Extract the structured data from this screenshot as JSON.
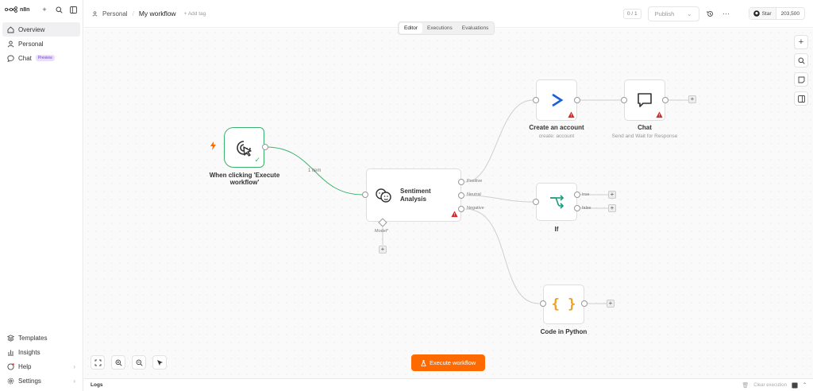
{
  "sidebar": {
    "logo": "n8n",
    "items": [
      {
        "label": "Overview"
      },
      {
        "label": "Personal"
      },
      {
        "label": "Chat",
        "badge": "Preview"
      }
    ],
    "bottom": [
      {
        "label": "Templates"
      },
      {
        "label": "Insights"
      },
      {
        "label": "Help"
      },
      {
        "label": "Settings"
      }
    ]
  },
  "header": {
    "project": "Personal",
    "workflow": "My workflow",
    "add_tag": "+ Add tag",
    "counter": "0 / 1",
    "publish": "Publish",
    "github_star": "Star",
    "github_count": "203,500"
  },
  "tabs": [
    "Editor",
    "Executions",
    "Evaluations"
  ],
  "nodes": {
    "trigger": {
      "title": "When clicking 'Execute",
      "title2": "workflow'"
    },
    "sentiment": {
      "title": "Sentiment",
      "title2": "Analysis",
      "model_label": "Model*",
      "outputs": [
        "Positive",
        "Neutral",
        "Negative"
      ]
    },
    "account": {
      "title": "Create an account",
      "subtitle": "create: account"
    },
    "chat": {
      "title": "Chat",
      "subtitle": "Send and Wait for Response"
    },
    "if": {
      "title": "If",
      "outputs": [
        "true",
        "false"
      ]
    },
    "code": {
      "title": "Code in Python"
    }
  },
  "edge_label": "1 item",
  "execute_button": "Execute workflow",
  "logs": {
    "title": "Logs",
    "clear": "Clear execution"
  },
  "colors": {
    "accent": "#ff6a00",
    "success": "#3bb26b",
    "warning": "#d42a2a"
  }
}
